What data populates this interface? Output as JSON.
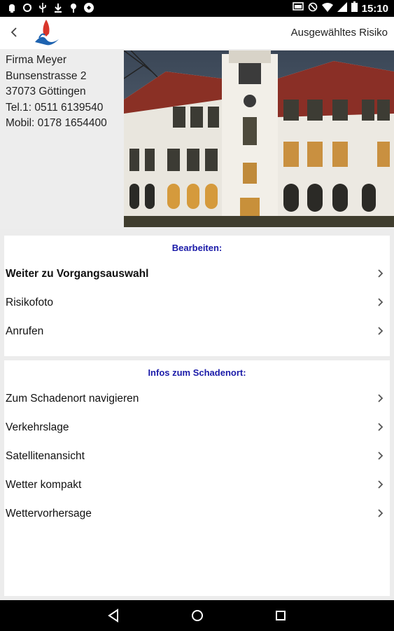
{
  "status_bar": {
    "time": "15:10",
    "left_icons": [
      "notification-icon",
      "sync-icon",
      "usb-icon",
      "download-icon",
      "location-icon",
      "app-icon"
    ],
    "right_icons": [
      "cast-icon",
      "do-not-disturb-icon",
      "wifi-icon",
      "signal-icon",
      "battery-icon"
    ]
  },
  "app_bar": {
    "title": "Ausgewähltes Risiko"
  },
  "contact": {
    "company": "Firma Meyer",
    "street": "Bunsenstrasse 2",
    "city": "37073 Göttingen",
    "phone": "Tel.1: 0511 6139540",
    "mobile": "Mobil: 0178 1654400"
  },
  "edit_section": {
    "title": "Bearbeiten:",
    "items": [
      {
        "label": "Weiter zu Vorgangsauswahl",
        "bold": true
      },
      {
        "label": "Risikofoto",
        "bold": false
      },
      {
        "label": "Anrufen",
        "bold": false
      }
    ]
  },
  "location_section": {
    "title": "Infos zum Schadenort:",
    "items": [
      {
        "label": "Zum Schadenort navigieren"
      },
      {
        "label": "Verkehrslage"
      },
      {
        "label": "Satellitenansicht"
      },
      {
        "label": "Wetter kompakt"
      },
      {
        "label": "Wettervorhersage"
      }
    ]
  },
  "colors": {
    "section_title": "#1a1aa8",
    "logo_red": "#d9362b",
    "logo_blue": "#1e63b0"
  }
}
